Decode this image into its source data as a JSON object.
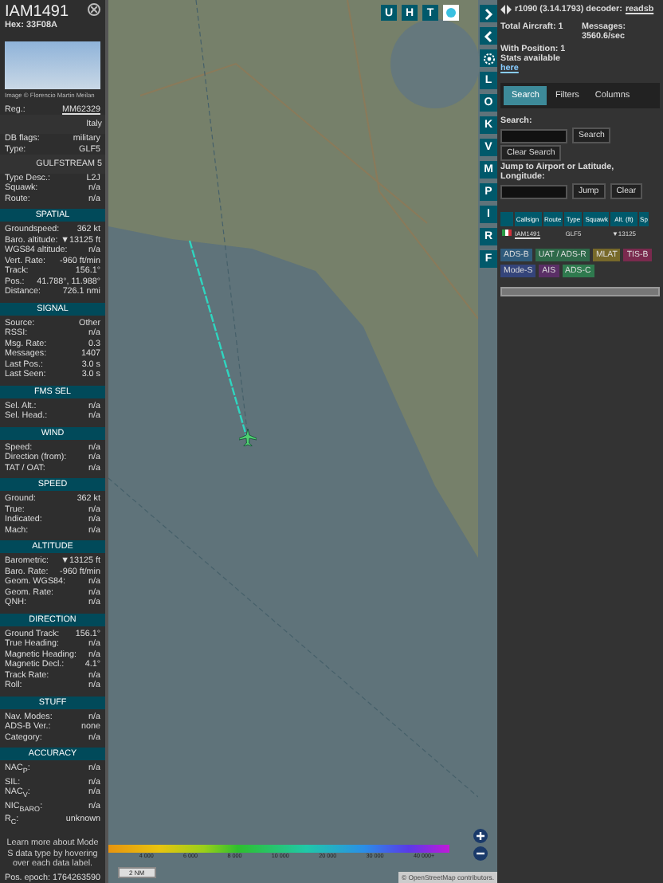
{
  "aircraft": {
    "callsign": "IAM1491",
    "hex": "Hex: 33F08A",
    "photo_credit": "Image © Florencio Martin Meilan"
  },
  "info_rows": [
    {
      "label": "Reg.:",
      "value": "MM62329",
      "link": true
    },
    {
      "value": "Italy",
      "link": false
    },
    {
      "label": "DB flags:",
      "value": "military",
      "link": false
    },
    {
      "label": "Type:",
      "value": "GLF5",
      "link": false
    },
    {
      "value": "GULFSTREAM 5",
      "link": false
    },
    {
      "label": "Type Desc.:",
      "value": "L2J",
      "link": false
    },
    {
      "label": "Squawk:",
      "value": "n/a",
      "link": false
    },
    {
      "label": "Route:",
      "value": "n/a",
      "link": false
    }
  ],
  "sections": [
    {
      "title": "SPATIAL",
      "rows": [
        {
          "label": "Groundspeed:",
          "value": "362 kt"
        },
        {
          "label": "Baro. altitude:",
          "value": "▼13125 ft"
        },
        {
          "label": "WGS84 altitude:",
          "value": "n/a"
        },
        {
          "label": "Vert. Rate:",
          "value": "-960 ft/min"
        },
        {
          "label": "Track:",
          "value": "156.1°"
        },
        {
          "label": "Pos.:",
          "value": "41.788°, 11.988°"
        },
        {
          "label": "Distance:",
          "value": "726.1 nmi"
        }
      ]
    },
    {
      "title": "SIGNAL",
      "rows": [
        {
          "label": "Source:",
          "value": "Other"
        },
        {
          "label": "RSSI:",
          "value": "n/a"
        },
        {
          "label": "Msg. Rate:",
          "value": "0.3"
        },
        {
          "label": "Messages:",
          "value": "1407"
        },
        {
          "label": "Last Pos.:",
          "value": "3.0 s"
        },
        {
          "label": "Last Seen:",
          "value": "3.0 s"
        }
      ]
    },
    {
      "title": "FMS SEL",
      "rows": [
        {
          "label": "Sel. Alt.:",
          "value": "n/a"
        },
        {
          "label": "Sel. Head.:",
          "value": "n/a"
        }
      ]
    },
    {
      "title": "WIND",
      "rows": [
        {
          "label": "Speed:",
          "value": "n/a"
        },
        {
          "label": "Direction (from):",
          "value": "n/a"
        },
        {
          "label": "TAT / OAT:",
          "value": "n/a"
        }
      ]
    },
    {
      "title": "SPEED",
      "rows": [
        {
          "label": "Ground:",
          "value": "362 kt"
        },
        {
          "label": "True:",
          "value": "n/a"
        },
        {
          "label": "Indicated:",
          "value": "n/a"
        },
        {
          "label": "Mach:",
          "value": "n/a"
        }
      ]
    },
    {
      "title": "ALTITUDE",
      "rows": [
        {
          "label": "Barometric:",
          "value": "▼13125 ft"
        },
        {
          "label": "Baro. Rate:",
          "value": "-960 ft/min"
        },
        {
          "label": "Geom. WGS84:",
          "value": "n/a"
        },
        {
          "label": "Geom. Rate:",
          "value": "n/a"
        },
        {
          "label": "QNH:",
          "value": "n/a"
        }
      ]
    },
    {
      "title": "DIRECTION",
      "rows": [
        {
          "label": "Ground Track:",
          "value": "156.1°"
        },
        {
          "label": "True Heading:",
          "value": "n/a"
        },
        {
          "label": "Magnetic Heading:",
          "value": "n/a"
        },
        {
          "label": "Magnetic Decl.:",
          "value": "4.1°"
        },
        {
          "label": "Track Rate:",
          "value": "n/a"
        },
        {
          "label": "Roll:",
          "value": "n/a"
        }
      ]
    },
    {
      "title": "STUFF",
      "rows": [
        {
          "label": "Nav. Modes:",
          "value": "n/a"
        },
        {
          "label": "ADS-B Ver.:",
          "value": "none"
        },
        {
          "label": "Category:",
          "value": "n/a"
        }
      ]
    },
    {
      "title": "ACCURACY",
      "rows": [
        {
          "label": "NAC$_{P}$:",
          "value": "n/a"
        },
        {
          "label": "SIL:",
          "value": "n/a"
        },
        {
          "label": "NAC$_{V}$:",
          "value": "n/a"
        },
        {
          "label": "NIC$_{BARO}$:",
          "value": "n/a"
        },
        {
          "label": "R$_{C}$:",
          "value": "unknown"
        }
      ]
    }
  ],
  "note": "Learn more about Mode S data type by hovering over each data label.",
  "pos_epoch": {
    "label": "Pos. epoch:",
    "value": "1764263590"
  },
  "map": {
    "top_buttons": [
      "U",
      "H",
      "T"
    ],
    "side_buttons": [
      {
        "kind": "next"
      },
      {
        "kind": "prev"
      },
      {
        "kind": "settings"
      },
      {
        "kind": "letter",
        "label": "L"
      },
      {
        "kind": "letter",
        "label": "O"
      },
      {
        "kind": "letter",
        "label": "K"
      },
      {
        "kind": "letter",
        "label": "V"
      },
      {
        "kind": "letter",
        "label": "M"
      },
      {
        "kind": "letter",
        "label": "P"
      },
      {
        "kind": "letter",
        "label": "I"
      },
      {
        "kind": "letter",
        "label": "R"
      },
      {
        "kind": "letter",
        "label": "F"
      }
    ],
    "legend": [
      "4 000",
      "6 000",
      "8 000",
      "10 000",
      "20 000",
      "30 000",
      "40 000+"
    ],
    "scale": "2 NM",
    "attribution": "© OpenStreetMap contributors."
  },
  "panel": {
    "version": "r1090 (3.14.1793) decoder:",
    "decoder": "readsb",
    "total": "Total Aircraft: 1",
    "messages": "Messages: 3560.6/sec",
    "with_position": "With Position: 1",
    "stats": "Stats available",
    "stats_link": "here",
    "tabs": [
      {
        "label": "Search",
        "selected": true
      },
      {
        "label": "Filters",
        "selected": false
      },
      {
        "label": "Columns",
        "selected": false
      }
    ],
    "search_label": "Search:",
    "search_button": "Search",
    "clear_search": "Clear Search",
    "jump_label": "Jump to Airport or Latitude, Longitude:",
    "jump_button": "Jump",
    "clear_button": "Clear",
    "columns": [
      "Callsign",
      "Route",
      "Type",
      "Squawk",
      "Alt. (ft)",
      "Sp"
    ],
    "rows": [
      {
        "callsign": "IAM1491",
        "type": "GLF5",
        "alt": "▼13125",
        "selected": false
      }
    ],
    "sources": [
      {
        "label": "ADS-B",
        "color": "#2f5b7c"
      },
      {
        "label": "UAT / ADS-R",
        "color": "#2f6a4a"
      },
      {
        "label": "MLAT",
        "color": "#77692a"
      },
      {
        "label": "TIS-B",
        "color": "#7a2a4e"
      },
      {
        "label": "Mode-S",
        "color": "#34447a"
      },
      {
        "label": "AIS",
        "color": "#5a2f66"
      },
      {
        "label": "ADS-C",
        "color": "#2f7a4e"
      }
    ]
  }
}
